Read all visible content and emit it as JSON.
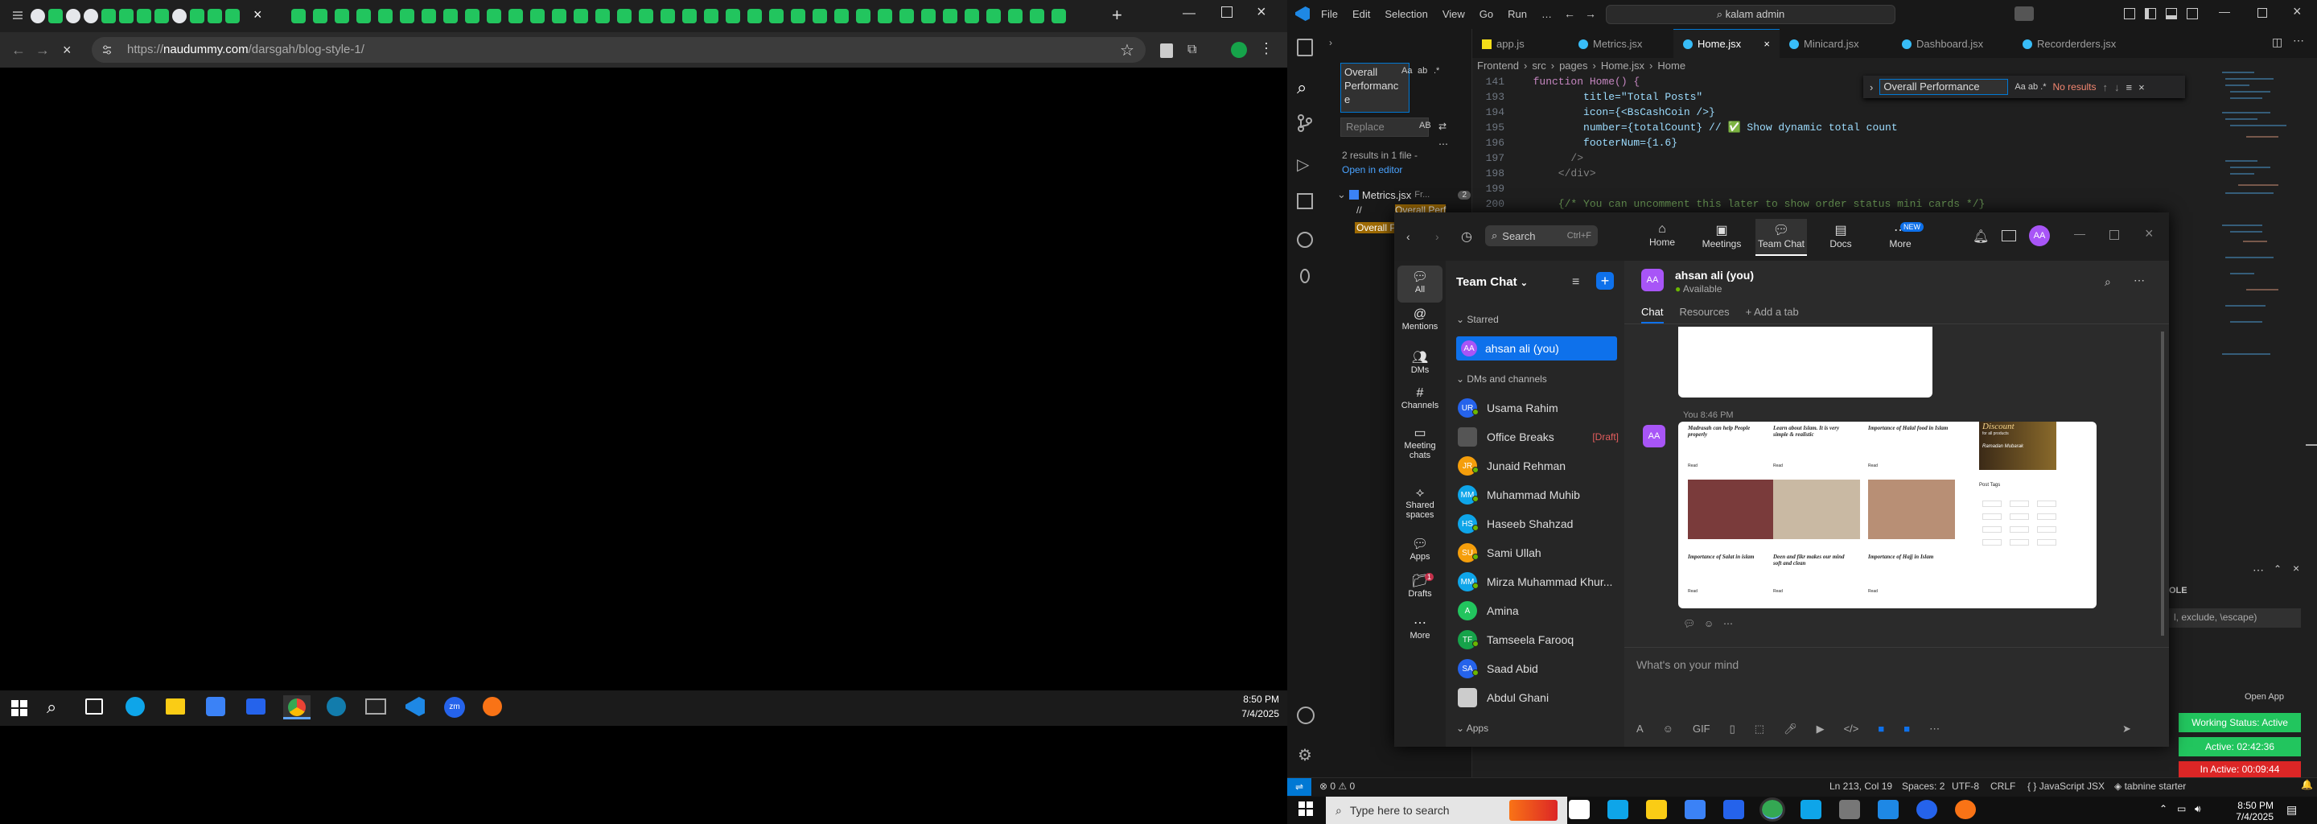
{
  "browser": {
    "url_prefix": "https://",
    "url_domain": "naudummy.com",
    "url_path": "/darsgah/blog-style-1/"
  },
  "taskbar_left": {
    "time": "8:50 PM",
    "date": "7/4/2025"
  },
  "vscode": {
    "menu": [
      "File",
      "Edit",
      "Selection",
      "View",
      "Go",
      "Run",
      "…"
    ],
    "search_box": "kalam admin",
    "tabs": [
      "app.js",
      "Metrics.jsx",
      "Home.jsx",
      "Minicard.jsx",
      "Dashboard.jsx",
      "Recorderders.jsx"
    ],
    "active_tab": "Home.jsx",
    "breadcrumb": [
      "Frontend",
      "src",
      "pages",
      "Home.jsx",
      "Home"
    ],
    "search_panel": {
      "query": "Overall Performanc e",
      "replace_placeholder": "Replace",
      "results": "2 results in 1 file -",
      "open_in_editor": "Open in editor",
      "file": "Metrics.jsx",
      "file_suffix": "Fr...",
      "file_count": "2",
      "match1": "//",
      "match1_highlight": "Overall Perf",
      "match2": "Overall P"
    },
    "find_widget": {
      "query": "Overall Performance",
      "opts": "Aa  ab  .*",
      "result": "No results"
    },
    "code_lines": [
      {
        "n": "141",
        "t": "  function Home() {"
      },
      {
        "n": "193",
        "t": "          title=\"Total Posts\""
      },
      {
        "n": "194",
        "t": "          icon={<BsCashCoin />}"
      },
      {
        "n": "195",
        "t": "          number={totalCount} // ✅ Show dynamic total count"
      },
      {
        "n": "196",
        "t": "          footerNum={1.6}"
      },
      {
        "n": "197",
        "t": "        />"
      },
      {
        "n": "198",
        "t": "      </div>"
      },
      {
        "n": "199",
        "t": ""
      },
      {
        "n": "200",
        "t": "      {/* You can uncomment this later to show order status mini cards */}"
      }
    ],
    "status": {
      "errors": "0",
      "warnings": "0",
      "position": "Ln 213, Col 19",
      "spaces": "Spaces: 2",
      "encoding": "UTF-8",
      "eol": "CRLF",
      "language": "JavaScript JSX",
      "ext": "tabnine starter"
    },
    "panel_label": "OLE",
    "panel_input": "l, exclude, \\escape)",
    "open_app": "Open App",
    "working_status": "Working Status: Active",
    "active_time": "Active: 02:42:36",
    "inactive_time": "In Active: 00:09:44"
  },
  "teams": {
    "search": "Search",
    "shortcut": "Ctrl+F",
    "top_nav": [
      "Home",
      "Meetings",
      "Team Chat",
      "Docs",
      "More"
    ],
    "top_badge": "NEW",
    "user_initials": "AA",
    "left_nav": [
      "All",
      "Mentions",
      "DMs",
      "Channels",
      "Meeting chats",
      "Shared spaces",
      "Apps",
      "Drafts",
      "More"
    ],
    "drafts_badge": "1",
    "list_title": "Team Chat",
    "starred": "Starred",
    "starred_item": "ahsan ali (you)",
    "dms_header": "DMs and channels",
    "contacts": [
      {
        "init": "UR",
        "name": "Usama Rahim",
        "color": "#2563eb"
      },
      {
        "init": "",
        "name": "Office Breaks",
        "color": "#555",
        "draft": "[Draft]"
      },
      {
        "init": "JR",
        "name": "Junaid Rehman",
        "color": "#f59e0b"
      },
      {
        "init": "MM",
        "name": "Muhammad Muhib",
        "color": "#0ea5e9"
      },
      {
        "init": "HS",
        "name": "Haseeb Shahzad",
        "color": "#0ea5e9"
      },
      {
        "init": "SU",
        "name": "Sami Ullah",
        "color": "#f59e0b"
      },
      {
        "init": "MM",
        "name": "Mirza Muhammad Khur...",
        "color": "#0ea5e9"
      },
      {
        "init": "A",
        "name": "Amina",
        "color": "#22c55e"
      },
      {
        "init": "TF",
        "name": "Tamseela Farooq",
        "color": "#16a34a"
      },
      {
        "init": "SA",
        "name": "Saad Abid",
        "color": "#2563eb"
      },
      {
        "init": "",
        "name": "Abdul Ghani",
        "color": "#ccc"
      }
    ],
    "apps_header": "Apps",
    "chat_name": "ahsan ali (you)",
    "chat_status": "Available",
    "chat_tabs": [
      "Chat",
      "Resources",
      "+ Add a tab"
    ],
    "msg_time": "You 8:46 PM",
    "blog": {
      "titles": [
        "Madrasah can help People properly",
        "Learn about Islam. It is very simple & realistic",
        "Importance of Halal food in Islam"
      ],
      "titles2": [
        "Importance of Salat in islam",
        "Deen and fikr makes our mind soft and clean",
        "Importance of Hajj in Islam"
      ],
      "readmore": "Read",
      "discount": "Discount",
      "discount_sub": "for all products",
      "ramadan": "Ramadan Mubarak",
      "tags": "Post Tags"
    },
    "composer_placeholder": "What's on your mind"
  },
  "taskbar_right": {
    "search_placeholder": "Type here to search",
    "time": "8:50 PM",
    "date": "7/4/2025"
  }
}
